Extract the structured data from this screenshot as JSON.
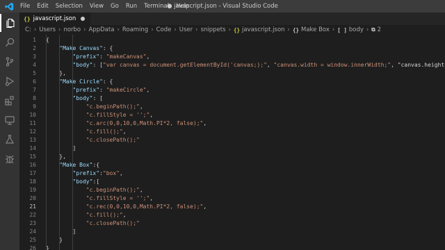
{
  "app": {
    "window_title": "● javascript.json - Visual Studio Code",
    "menu": [
      "File",
      "Edit",
      "Selection",
      "View",
      "Go",
      "Run",
      "Terminal",
      "Help"
    ],
    "app_icon": "vscode-logo-icon",
    "accent": "#007acc"
  },
  "activity_bar": {
    "items": [
      {
        "name": "explorer-icon"
      },
      {
        "name": "search-icon"
      },
      {
        "name": "source-control-icon"
      },
      {
        "name": "run-debug-icon"
      },
      {
        "name": "extensions-icon"
      },
      {
        "name": "remote-explorer-icon"
      },
      {
        "name": "testing-icon"
      },
      {
        "name": "bug-icon"
      }
    ]
  },
  "tabs": [
    {
      "icon_text": "{}",
      "label": "javascript.json",
      "modified": true
    }
  ],
  "breadcrumb": {
    "drive": "C:",
    "parts": [
      "Users",
      "norbo",
      "AppData",
      "Roaming",
      "Code",
      "User",
      "snippets"
    ],
    "file_icon": "{}",
    "file": "javascript.json",
    "sym1_icon": "{}",
    "sym1": "Make Box",
    "sym2_icon": "[ ]",
    "sym2": "body",
    "sym3_icon": "⧉",
    "sym3": "2"
  },
  "editor": {
    "current_line": 21,
    "lines": [
      {
        "n": "1",
        "text": "{"
      },
      {
        "n": "2",
        "text": "    \"Make Canvas\": {"
      },
      {
        "n": "3",
        "text": "        \"prefix\": \"makeCanvas\","
      },
      {
        "n": "4",
        "text": "        \"body\": [\"var canvas = document.getElementById('canvas;);\", \"canvas.width = window.innerWidth;\", \"canvas.height = window.i"
      },
      {
        "n": "5",
        "text": "    },"
      },
      {
        "n": "6",
        "text": "    \"Make Circle\": {"
      },
      {
        "n": "7",
        "text": "        \"prefix\": \"makeCircle\","
      },
      {
        "n": "8",
        "text": "        \"body\": ["
      },
      {
        "n": "9",
        "text": "            \"c.beginPath();\","
      },
      {
        "n": "10",
        "text": "            \"c.fillStyle = '';\","
      },
      {
        "n": "11",
        "text": "            \"c.arc(0,0,10,0,Math.PI*2, false);\","
      },
      {
        "n": "12",
        "text": "            \"c.fill();\","
      },
      {
        "n": "13",
        "text": "            \"c.closePath();\""
      },
      {
        "n": "14",
        "text": "        ]"
      },
      {
        "n": "15",
        "text": "    },"
      },
      {
        "n": "16",
        "text": "    \"Make Box\":{"
      },
      {
        "n": "17",
        "text": "        \"prefix\":\"box\","
      },
      {
        "n": "18",
        "text": "        \"body\":["
      },
      {
        "n": "19",
        "text": "            \"c.beginPath();\","
      },
      {
        "n": "20",
        "text": "            \"c.fillStyle = '';\","
      },
      {
        "n": "21",
        "text": "            \"c.rec(0,0,10,0,Math.PI*2, false);\","
      },
      {
        "n": "22",
        "text": "            \"c.fill();\","
      },
      {
        "n": "23",
        "text": "            \"c.closePath();\""
      },
      {
        "n": "24",
        "text": "        ]"
      },
      {
        "n": "25",
        "text": "    }"
      },
      {
        "n": "26",
        "text": "}"
      }
    ]
  }
}
